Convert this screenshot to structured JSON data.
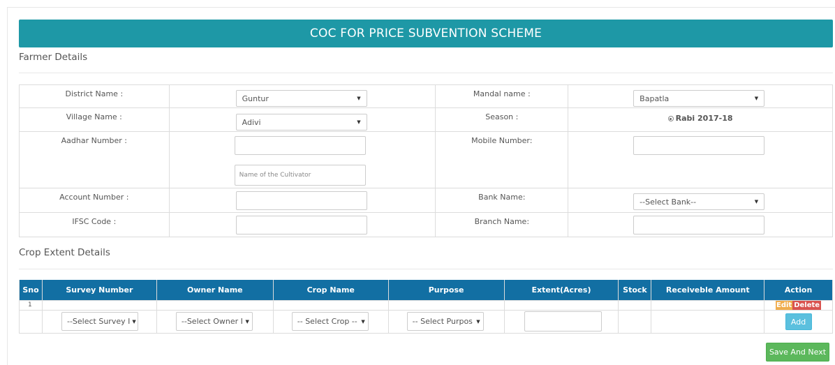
{
  "page": {
    "title": "COC FOR PRICE SUBVENTION SCHEME"
  },
  "farmer": {
    "section_title": "Farmer Details",
    "district_label": "District Name :",
    "district_value": "Guntur",
    "mandal_label": "Mandal name :",
    "mandal_value": "Bapatla",
    "village_label": "Village Name :",
    "village_value": "Adivi",
    "season_label": "Season :",
    "season_value": "Rabi 2017-18",
    "aadhar_label": "Aadhar Number :",
    "aadhar_value": "",
    "cultivator_placeholder": "Name of the Cultivator",
    "mobile_label": "Mobile Number:",
    "mobile_value": "",
    "account_label": "Account Number :",
    "account_value": "",
    "bank_label": "Bank Name:",
    "bank_value": "--Select Bank--",
    "ifsc_label": "IFSC Code :",
    "ifsc_value": "",
    "branch_label": "Branch Name:",
    "branch_value": ""
  },
  "crop": {
    "section_title": "Crop Extent Details",
    "columns": [
      "Sno",
      "Survey Number",
      "Owner Name",
      "Crop Name",
      "Purpose",
      "Extent(Acres)",
      "Stock",
      "Receiveble Amount",
      "Action"
    ],
    "row1": {
      "sno": "1",
      "edit": "Edit",
      "delete": "Delete"
    },
    "survey_select": "--Select Survey I",
    "owner_select": "--Select Owner I",
    "crop_select": "-- Select Crop --",
    "purpose_select": "-- Select Purpos",
    "extent_value": "",
    "add_label": "Add"
  },
  "footer": {
    "save_label": "Save And Next"
  },
  "colors": {
    "banner": "#1e98a6",
    "table_header": "#126fa3",
    "save": "#5cb85c",
    "add": "#5bc0de",
    "edit": "#f0ad4e",
    "delete": "#d9534f"
  }
}
